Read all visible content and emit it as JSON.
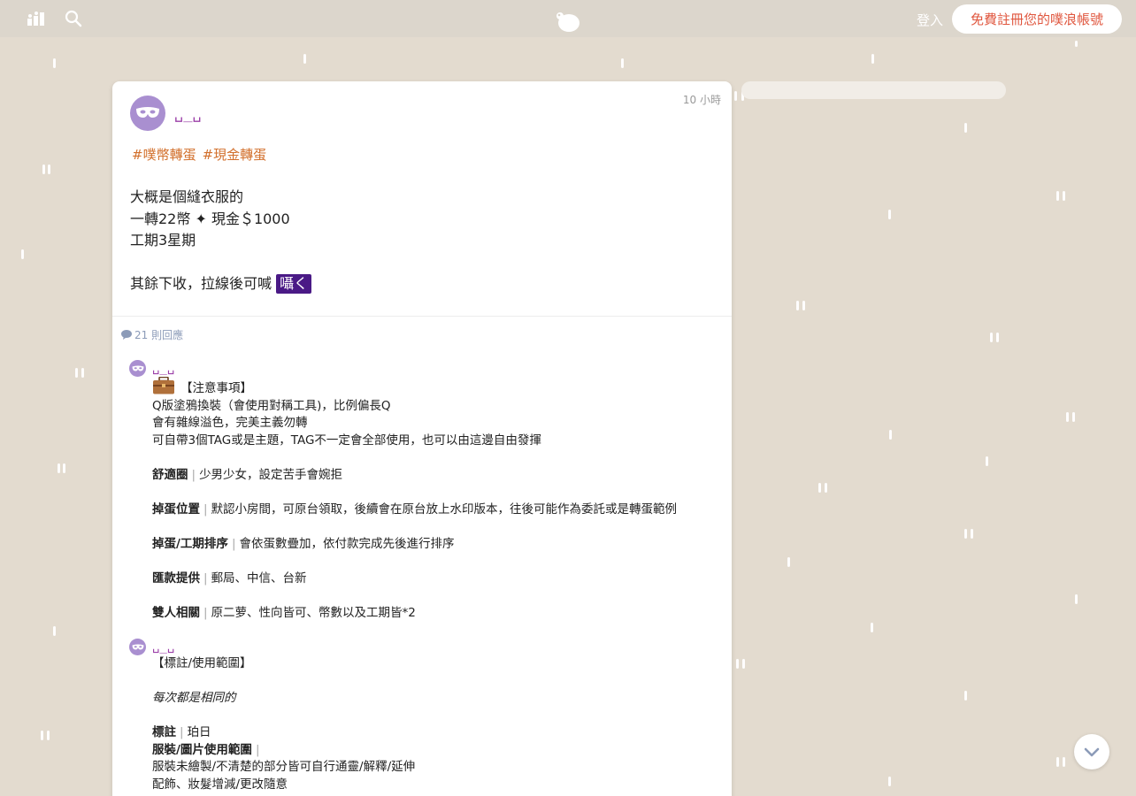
{
  "topbar": {
    "login_label": "登入",
    "signup_label": "免費註冊您的噗浪帳號"
  },
  "post": {
    "author": "␣_␣",
    "time": "10 小時",
    "tags": [
      "#噗幣轉蛋",
      "#現金轉蛋"
    ],
    "lines": [
      "大概是個縫衣服的",
      "一轉22幣 ✦ 現金＄1000",
      "工期3星期"
    ],
    "last_line_text": "其餘下收，拉線後可喊",
    "last_line_highlight": "囁く"
  },
  "replies": {
    "count_label": "21 則回應",
    "items": [
      {
        "author": "␣_␣",
        "heading": "【注意事項】",
        "lines": [
          "Q版塗鴉換裝（會使用對稱工具)，比例偏長Q",
          "會有雜線溢色，完美主義勿轉",
          "可自帶3個TAG或是主題，TAG不一定會全部使用，也可以由這邊自由發揮"
        ],
        "fields": [
          {
            "label": "舒適圈",
            "value": "少男少女，設定苦手會婉拒"
          },
          {
            "label": "掉蛋位置",
            "value": "默認小房間，可原台領取，後續會在原台放上水印版本，往後可能作為委託或是轉蛋範例"
          },
          {
            "label": "掉蛋/工期排序",
            "value": "會依蛋數疊加，依付款完成先後進行排序"
          },
          {
            "label": "匯款提供",
            "value": "郵局、中信、台新"
          },
          {
            "label": "雙人相關",
            "value": "原二萝、性向皆可、幣數以及工期皆*2"
          }
        ]
      },
      {
        "author": "␣_␣",
        "heading": "【標註/使用範圍】",
        "italic": "每次都是相同的",
        "mark_label": "標註",
        "mark_value": "珀日",
        "usage_label": "服裝/圖片使用範圍",
        "usage_lines": [
          "服裝未繪製/不清楚的部分皆可自行通靈/解釋/延伸",
          "配飾、妝髮增減/更改隨意"
        ]
      }
    ]
  },
  "icons": {
    "stats": "stats-icon",
    "search": "search-icon",
    "logo": "plurk-logo",
    "avatar": "mask-icon",
    "reply": "speech-bubble-icon",
    "bag": "briefcase-icon",
    "scroll": "chevron-down-icon"
  },
  "colors": {
    "background": "#e3dbcf",
    "topbar": "#dcd6cc",
    "signup_text": "#e0573f",
    "name": "#9b3fa8",
    "tag": "#d26f2b",
    "highlight": "#4a1a86",
    "avatar": "#a98fd0"
  }
}
